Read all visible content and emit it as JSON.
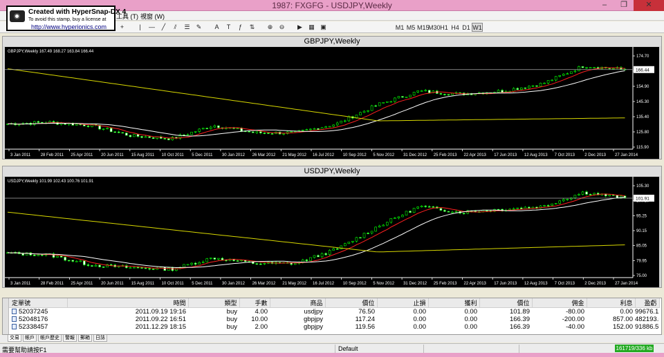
{
  "window": {
    "title": "1987: FXGFG - USDJPY,Weekly",
    "min_icon": "minimize-icon",
    "max_icon": "maximize-icon",
    "close_icon": "close-icon",
    "min_glyph": "–",
    "max_glyph": "❐",
    "close_glyph": "✕"
  },
  "menu": {
    "tools": "工具 (T)",
    "window": "視窗 (W)"
  },
  "watermark": {
    "line1": "Created with HyperSnap-DX 4",
    "line2": "To avoid this stamp, buy a license at",
    "line3": "http://www.hyperionics.com"
  },
  "toolbar": {
    "timeframes": [
      "M1",
      "M5",
      "M15",
      "M30",
      "H1",
      "H4",
      "D1",
      "W1"
    ],
    "active_timeframe": "W1",
    "draw_glyphs": [
      "+",
      "|",
      "—",
      "╱",
      "⫽",
      "☰",
      "✎",
      "A",
      "T",
      "ƒ",
      "⇅",
      "⊕",
      "⊖",
      "▶",
      "▦",
      "▣"
    ]
  },
  "charts": [
    {
      "name": "chart-gbpjpy",
      "window_title": "GBPJPY,Weekly",
      "info": "GBPJPY,Weekly  167.49 168.27 163.84 166.44",
      "current_price": "166.44",
      "price_labels": [
        "174.70",
        "165.15",
        "154.90",
        "145.30",
        "135.40",
        "125.80",
        "115.90"
      ],
      "date_labels": [
        "3 Jan 2011",
        "28 Feb 2011",
        "25 Apr 2011",
        "20 Jun 2011",
        "15 Aug 2011",
        "10 Oct 2011",
        "5 Dec 2011",
        "30 Jan 2012",
        "26 Mar 2012",
        "21 May 2012",
        "16 Jul 2012",
        "10 Sep 2012",
        "5 Nov 2012",
        "31 Dec 2012",
        "25 Feb 2013",
        "22 Apr 2013",
        "17 Jun 2013",
        "12 Aug 2013",
        "7 Oct 2013",
        "2 Dec 2013",
        "27 Jan 2014"
      ]
    },
    {
      "name": "chart-usdjpy",
      "window_title": "USDJPY,Weekly",
      "info": "USDJPY,Weekly  101.99 102.43 100.76 101.91",
      "current_price": "101.91",
      "price_labels": [
        "105.30",
        "100.20",
        "95.25",
        "90.15",
        "85.05",
        "79.95",
        "75.00"
      ],
      "date_labels": [
        "3 Jan 2011",
        "28 Feb 2011",
        "25 Apr 2011",
        "20 Jun 2011",
        "15 Aug 2011",
        "10 Oct 2011",
        "5 Dec 2011",
        "30 Jan 2012",
        "26 Mar 2012",
        "21 May 2012",
        "16 Jul 2012",
        "10 Sep 2012",
        "5 Nov 2012",
        "31 Dec 2012",
        "25 Feb 2013",
        "22 Apr 2013",
        "17 Jun 2013",
        "12 Aug 2013",
        "7 Oct 2013",
        "2 Dec 2013",
        "27 Jan 2014"
      ]
    }
  ],
  "chart_data": [
    {
      "type": "candlestick",
      "title": "GBPJPY,Weekly",
      "ylim": [
        113,
        177
      ],
      "x": [
        "2011-01",
        "2011-04",
        "2011-07",
        "2011-10",
        "2012-01",
        "2012-04",
        "2012-07",
        "2012-10",
        "2012-12",
        "2013-02",
        "2013-04",
        "2013-06",
        "2013-08",
        "2013-10",
        "2013-12",
        "2014-01"
      ],
      "close": [
        130,
        131,
        129,
        122,
        120,
        129,
        124,
        124,
        130,
        143,
        152,
        150,
        152,
        157,
        169,
        166.44
      ],
      "series": [
        {
          "name": "MA-red",
          "color": "#ff2020"
        },
        {
          "name": "MA-white",
          "color": "#ffffff"
        },
        {
          "name": "MA-yellow",
          "color": "#d8d800"
        }
      ]
    },
    {
      "type": "candlestick",
      "title": "USDJPY,Weekly",
      "ylim": [
        74,
        107
      ],
      "x": [
        "2011-01",
        "2011-04",
        "2011-07",
        "2011-10",
        "2012-01",
        "2012-04",
        "2012-07",
        "2012-10",
        "2012-12",
        "2013-02",
        "2013-04",
        "2013-06",
        "2013-08",
        "2013-10",
        "2013-12",
        "2014-01"
      ],
      "close": [
        82.5,
        82,
        78.5,
        77.5,
        77,
        81,
        79,
        79,
        84,
        92,
        99,
        97,
        98,
        99,
        104,
        101.91
      ],
      "series": [
        {
          "name": "MA-red",
          "color": "#ff2020"
        },
        {
          "name": "MA-white",
          "color": "#ffffff"
        },
        {
          "name": "MA-yellow",
          "color": "#d8d800"
        }
      ]
    }
  ],
  "orders": {
    "headers": [
      "定單號",
      "時間",
      "類型",
      "手數",
      "商品",
      "價位",
      "止損",
      "獲利",
      "價位",
      "佣金",
      "利息",
      "盈虧"
    ],
    "rows": [
      [
        "52037245",
        "2011.09.19 19:16",
        "buy",
        "4.00",
        "usdjpy",
        "76.50",
        "0.00",
        "0.00",
        "101.89",
        "-80.00",
        "0.00",
        "99676.12"
      ],
      [
        "52048176",
        "2011.09.22 16:51",
        "buy",
        "10.00",
        "gbpjpy",
        "117.24",
        "0.00",
        "0.00",
        "166.39",
        "-200.00",
        "857.00",
        "482193.66"
      ],
      [
        "52338457",
        "2011.12.29 18:15",
        "buy",
        "2.00",
        "gbpjpy",
        "119.56",
        "0.00",
        "0.00",
        "166.39",
        "-40.00",
        "152.00",
        "91886.59"
      ]
    ]
  },
  "tabs": [
    "交易",
    "帳戶",
    "帳戶歷史",
    "警報",
    "郵箱",
    "日誌"
  ],
  "status": {
    "help": "需要幫助請按F1",
    "profile": "Default",
    "connection": "161719/336 kb"
  }
}
